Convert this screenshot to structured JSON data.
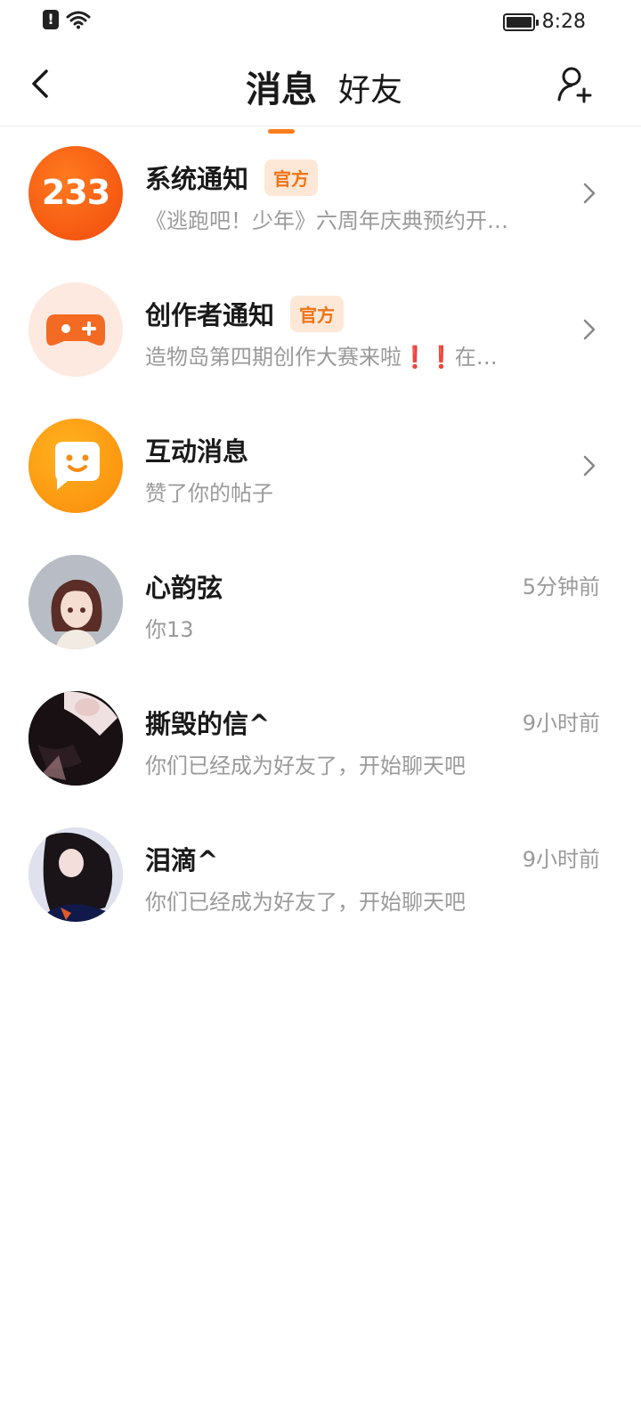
{
  "status_bar": {
    "time": "8:28"
  },
  "header": {
    "tab_messages": "消息",
    "tab_friends": "好友"
  },
  "list": [
    {
      "title": "系统通知",
      "badge": "官方",
      "subtitle": "《逃跑吧！少年》六周年庆典预约开…",
      "avatar_text": "233"
    },
    {
      "title": "创作者通知",
      "badge": "官方",
      "subtitle_a": "造物岛第四期创作大赛来啦",
      "subtitle_b": "❗❗",
      "subtitle_c": "在…"
    },
    {
      "title": "互动消息",
      "subtitle": "赞了你的帖子"
    },
    {
      "title": "心韵弦",
      "subtitle": "你13",
      "time": "5分钟前"
    },
    {
      "title": "撕毁的信^",
      "subtitle": "你们已经成为好友了，开始聊天吧",
      "time": "9小时前"
    },
    {
      "title": "泪滴^",
      "subtitle": "你们已经成为好友了，开始聊天吧",
      "time": "9小时前"
    }
  ],
  "colors": {
    "accent": "#ff7d1a",
    "badge_bg": "#fde8d8",
    "badge_text": "#f07316"
  }
}
